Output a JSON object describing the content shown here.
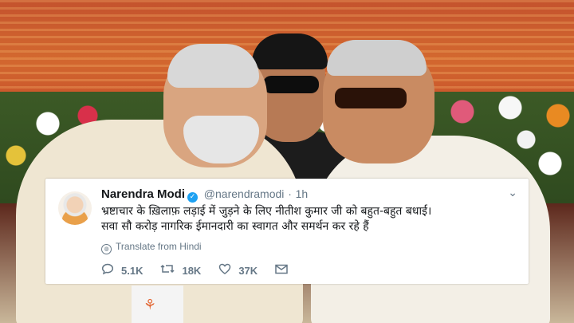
{
  "tweet": {
    "name": "Narendra Modi",
    "handle": "@narendramodi",
    "separator": "·",
    "time": "1h",
    "text_line1": "भ्रष्टाचार के ख़िलाफ़ लड़ाई में जुड़ने के लिए नीतीश कुमार जी को बहुत-बहुत बधाई।",
    "text_line2": "सवा सौ करोड़ नागरिक ईमानदारी का स्वागत और समर्थन कर रहे हैं",
    "translate_label": "Translate from Hindi",
    "reply_count": "5.1K",
    "retweet_count": "18K",
    "like_count": "37K",
    "verified_mark": "✓",
    "chevron": "⌄",
    "icons": {
      "reply": "reply-icon",
      "retweet": "retweet-icon",
      "like": "like-icon",
      "message": "message-icon"
    }
  },
  "colors": {
    "accent": "#1da1f2",
    "muted": "#657786",
    "text": "#14171a"
  }
}
